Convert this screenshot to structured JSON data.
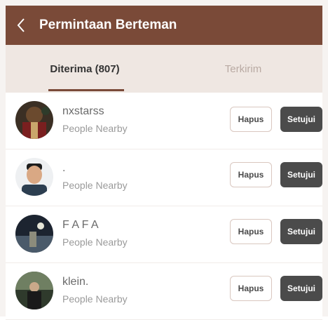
{
  "header": {
    "title": "Permintaan Berteman"
  },
  "tabs": {
    "received_label": "Diterima (807)",
    "sent_label": "Terkirim"
  },
  "requests": [
    {
      "name": "nxstarss",
      "source": "People Nearby",
      "delete_label": "Hapus",
      "accept_label": "Setujui"
    },
    {
      "name": ".",
      "source": "People Nearby",
      "delete_label": "Hapus",
      "accept_label": "Setujui"
    },
    {
      "name": "F A F A",
      "source": "People Nearby",
      "delete_label": "Hapus",
      "accept_label": "Setujui"
    },
    {
      "name": "klein.",
      "source": "People Nearby",
      "delete_label": "Hapus",
      "accept_label": "Setujui"
    }
  ],
  "colors": {
    "header_bg": "#7a4a38",
    "tabs_bg": "#efe7e2",
    "accept_bg": "#4b4b4b"
  }
}
